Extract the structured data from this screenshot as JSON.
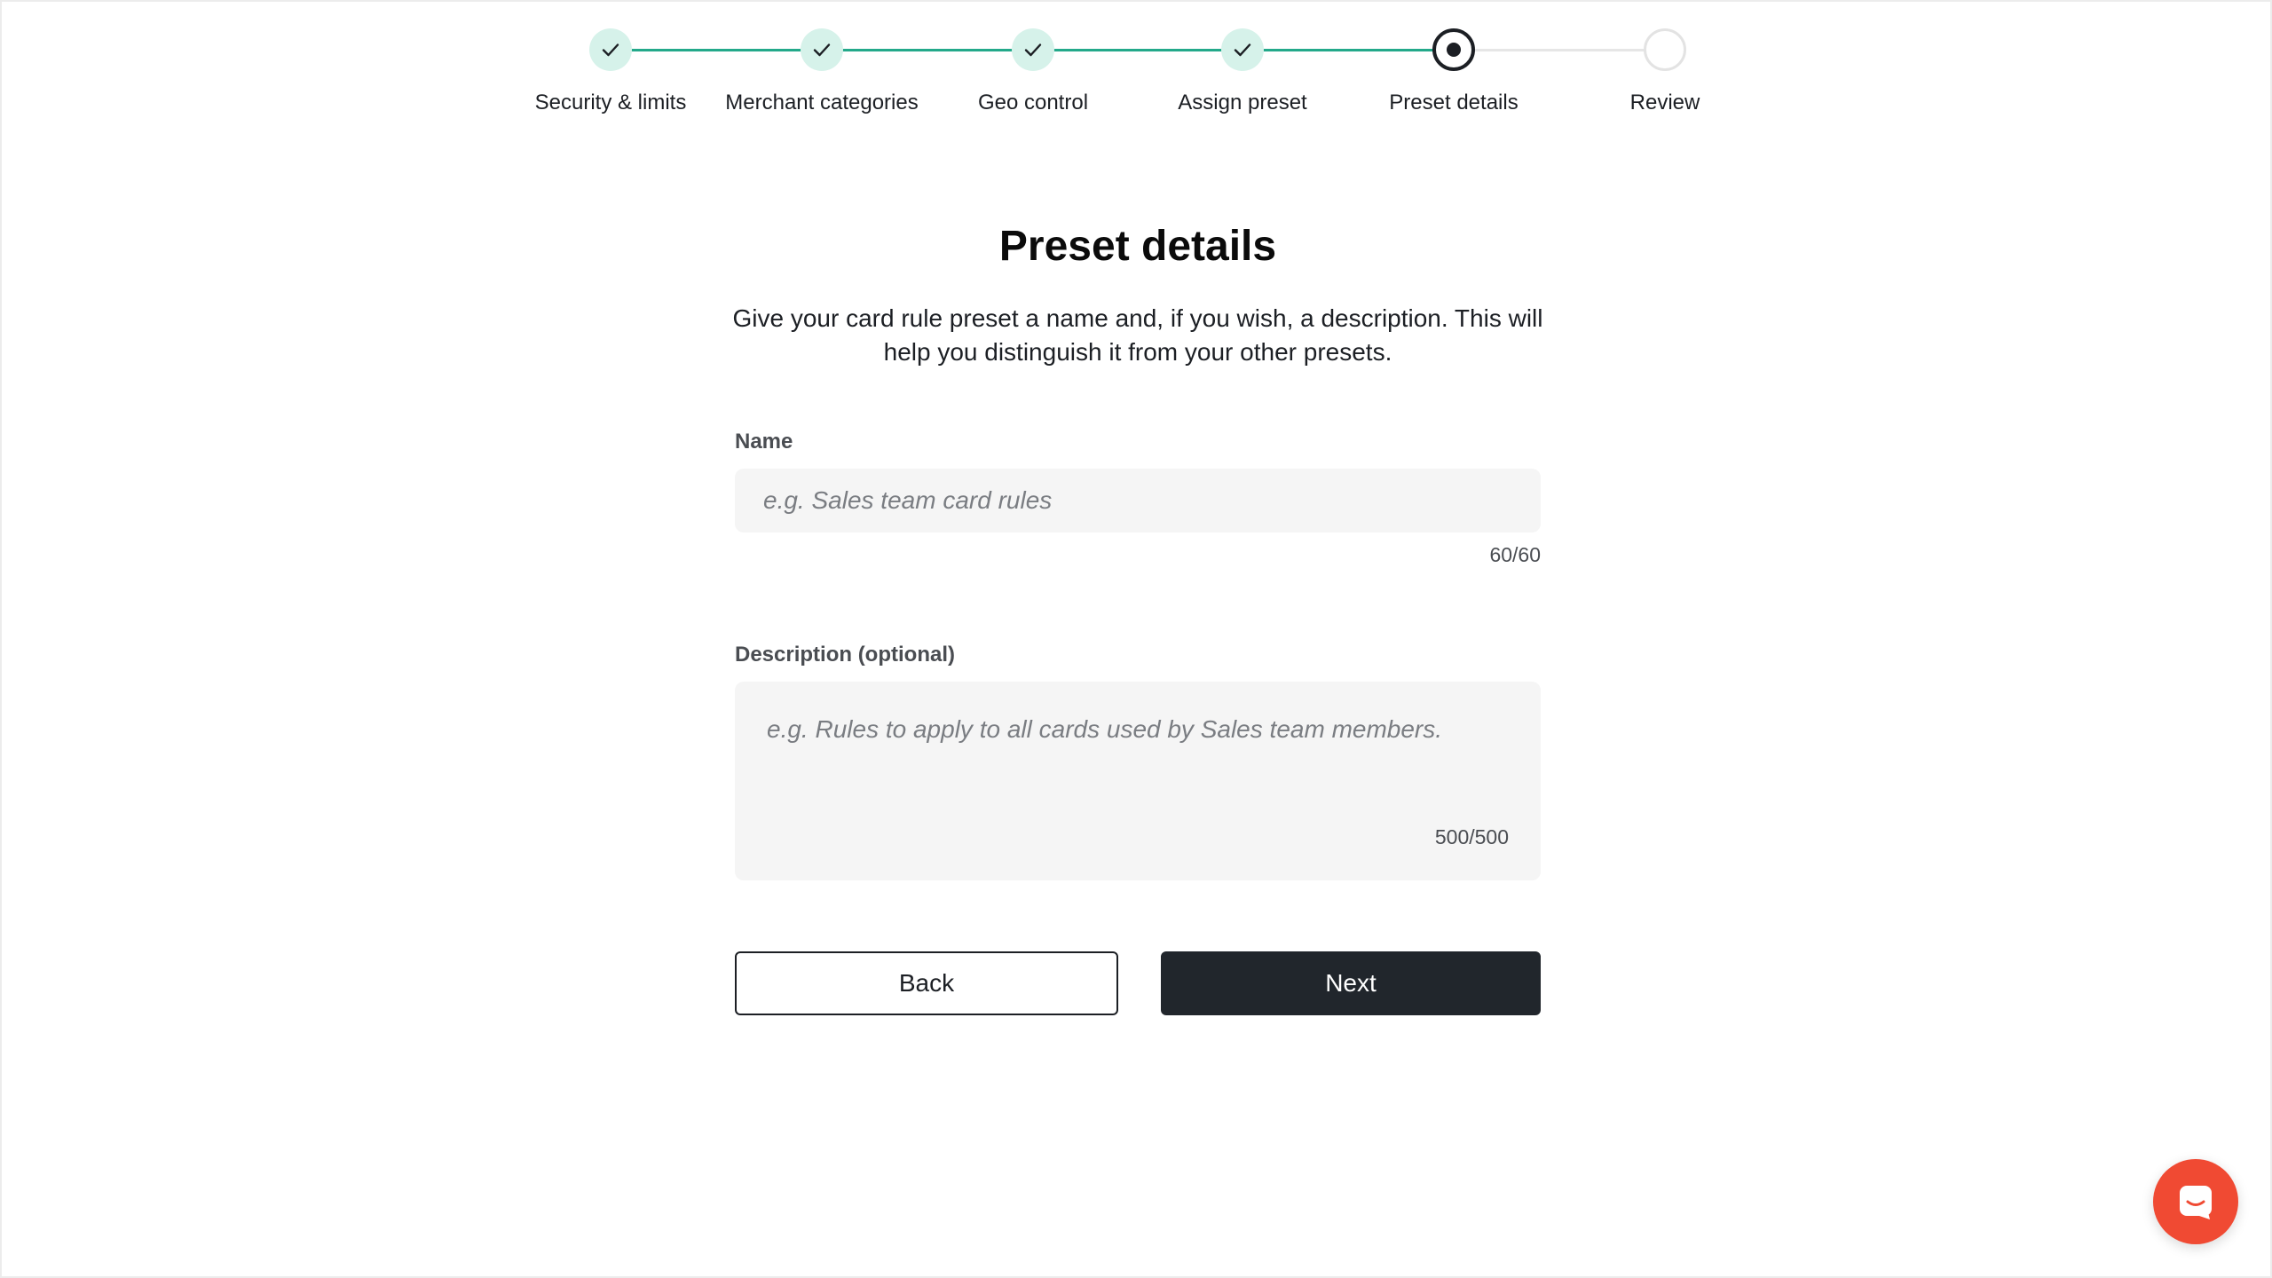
{
  "stepper": {
    "steps": [
      {
        "label": "Security & limits",
        "status": "done"
      },
      {
        "label": "Merchant categories",
        "status": "done"
      },
      {
        "label": "Geo control",
        "status": "done"
      },
      {
        "label": "Assign preset",
        "status": "done"
      },
      {
        "label": "Preset details",
        "status": "current"
      },
      {
        "label": "Review",
        "status": "todo"
      }
    ]
  },
  "page": {
    "title": "Preset details",
    "subtitle": "Give your card rule preset a name and, if you wish, a description. This will help you distinguish it from your other presets."
  },
  "form": {
    "name": {
      "label": "Name",
      "value": "",
      "placeholder": "e.g. Sales team card rules",
      "counter": "60/60"
    },
    "description": {
      "label": "Description (optional)",
      "value": "",
      "placeholder": "e.g. Rules to apply to all cards used by Sales team members.",
      "counter": "500/500"
    }
  },
  "actions": {
    "back_label": "Back",
    "next_label": "Next"
  },
  "colors": {
    "accent_done": "#23a98a",
    "done_circle_bg": "#d6f2ea",
    "primary_button": "#21262c",
    "chat_launcher": "#f04a33"
  },
  "icons": {
    "step_done": "check-icon",
    "step_current": "current-dot-icon",
    "chat": "chat-bubble-icon"
  }
}
